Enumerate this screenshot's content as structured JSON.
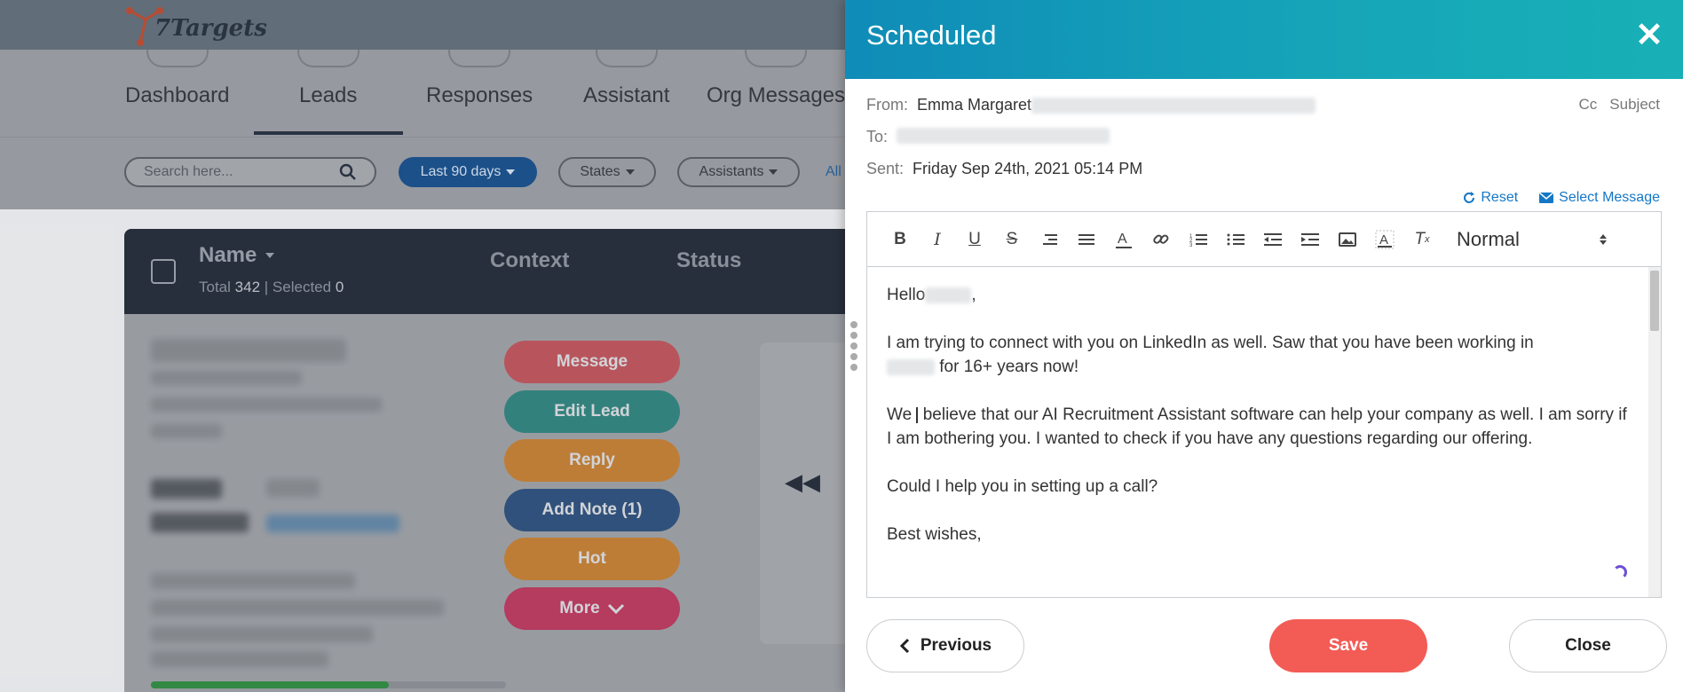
{
  "app": {
    "logo_text": "7Targets",
    "nav": [
      {
        "label": "Dashboard",
        "icon": "dashboard-icon"
      },
      {
        "label": "Leads",
        "icon": "users-icon"
      },
      {
        "label": "Responses",
        "icon": "mail-icon"
      },
      {
        "label": "Assistant",
        "icon": "assistant-icon"
      },
      {
        "label": "Org Messages",
        "icon": "org-messages-icon"
      }
    ],
    "filters": {
      "search_placeholder": "Search here...",
      "date_range": "Last 90 days",
      "states": "States",
      "assistants": "Assistants",
      "all": "All"
    },
    "table": {
      "col_name": "Name",
      "col_context": "Context",
      "col_status": "Status",
      "total_label": "Total",
      "total_value": "342",
      "separator": "|",
      "selected_label": "Selected",
      "selected_value": "0"
    },
    "actions": [
      "Message",
      "Edit Lead",
      "Reply",
      "Add Note (1)",
      "Hot",
      "More"
    ],
    "action_colors": [
      "#c8424a",
      "#157d77",
      "#cf7818",
      "#123e73",
      "#cf7818",
      "#c4204f"
    ],
    "progress_fraction": 0.67
  },
  "modal": {
    "title": "Scheduled",
    "from_label": "From:",
    "from_value": "Emma Margaret",
    "to_label": "To:",
    "sent_label": "Sent:",
    "sent_value": "Friday Sep 24th, 2021 05:14 PM",
    "cc_label": "Cc",
    "subject_label": "Subject",
    "reset_label": "Reset",
    "select_message_label": "Select Message",
    "format_select": "Normal",
    "body": {
      "greeting": "Hello",
      "p1": "I am trying to connect with you on LinkedIn as well. Saw that you have been working in",
      "p1b": "for 16+ years now!",
      "p2a": "We",
      "p2b": "believe that our AI Recruitment Assistant software can help your company as well.  I am sorry if I am bothering you. I wanted to check if you have any questions regarding our offering.",
      "p3": "Could I help you in setting up a call?",
      "p4": "Best wishes,"
    },
    "buttons": {
      "previous": "Previous",
      "save": "Save",
      "close": "Close"
    },
    "colors": {
      "header": "#0f9bb8",
      "save": "#f35b55",
      "link": "#1477c6"
    }
  }
}
